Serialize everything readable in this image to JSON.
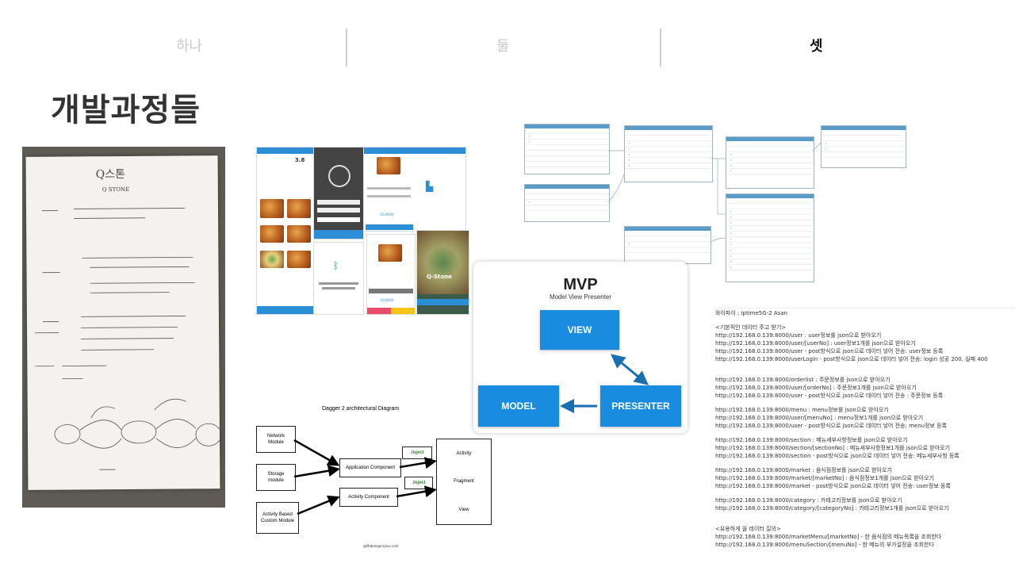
{
  "tabs": [
    {
      "label": "하나",
      "active": false
    },
    {
      "label": "둘",
      "active": false
    },
    {
      "label": "셋",
      "active": true
    }
  ],
  "title": "개발과정들",
  "photo": {
    "heading": "Q스톤",
    "subheading": "Q STONE"
  },
  "app_screens": {
    "rating": "3.8",
    "price": "15,000원",
    "splash_brand": "Q-Stone"
  },
  "mvp": {
    "title": "MVP",
    "subtitle": "Model View Presenter",
    "view": "VIEW",
    "model": "MODEL",
    "presenter": "PRESENTER"
  },
  "dagger": {
    "title": "Dagger 2 architectural Diagram",
    "network": "Network\nModule",
    "storage": "Storage\nmodule",
    "activity_module": "Activity Based\nCustom Module",
    "app_component": "Application Component",
    "activity_component": "Activity Component",
    "inject1": ".Inject",
    "inject2": ".Inject",
    "targets": [
      "Activity",
      "Fragment",
      "View"
    ],
    "credit": "@Mobologicsplus.com"
  },
  "api_notes": [
    "와이파이 : iptime5G-2 Asan",
    "",
    "<기본적인 데이터 주고 받기>",
    "http://192.168.0.139:8000/user : user정보를 json으로 받아오기",
    "http://192.168.0.139:8000/user/[userNo] : user정보1개를 json으로 받아오기",
    "http://192.168.0.139:8000/user - post방식으로 json으로 데이터 넣어 전송: user정보 등록",
    "http://192.168.0.139:8000/userLogin - post방식으로 json으로 데이터 넣어 전송: login 성공 200, 실패 400",
    "",
    "",
    "http://192.168.0.139:8000/orderlist : 주문정보를 json으로 받아오기",
    "http://192.168.0.139:8000/user/[orderNo] : 주문정보1개를 json으로 받아오기",
    "http://192.168.0.139:8000/user - post방식으로 json으로 데이터 넣어 전송 : 주문정보 등록",
    "",
    "http://192.168.0.139:8000/menu : menu정보를 json으로 받아오기",
    "http://192.168.0.139:8000/user/[menuNo] : menu정보1개를 json으로 받아오기",
    "http://192.168.0.139:8000/user - post방식으로 json으로 데이터 넣어 전송: menu정보 등록",
    "",
    "http://192.168.0.139:8000/section : 메뉴세부사항정보를 json으로 받아오기",
    "http://192.168.0.139:8000/section/[sectionNo] : 메뉴세부사항정보1개를 json으로 받아오기",
    "http://192.168.0.139:8000/section - post방식으로 json으로 데이터 넣어 전송: 메뉴세부사항 등록",
    "",
    "http://192.168.0.139:8000/market : 음식점정보를 json으로 받아오기",
    "http://192.168.0.139:8000/market/[marketNo] : 음식점정보1개를 json으로 받아오기",
    "http://192.168.0.139:8000/market - post방식으로 json으로 데이터 넣어 전송: user정보 등록",
    "",
    "http://192.168.0.139:8000/category : 카테고리정보를 json으로 받아오기",
    "http://192.168.0.139:8000/category/[categoryNo] : 카테고리정보1개를 json으로 받아오기",
    "",
    "",
    "<유용하게 쓸 데이터 질의>",
    "http://192.168.0.139:8000/marketMenu/[marketNo] - 한 음식점의 메뉴목록을 조회한다",
    "http://192.168.0.139:8000/menuSection/[menuNo] - 한 메뉴의 부가설정을 조회한다"
  ]
}
